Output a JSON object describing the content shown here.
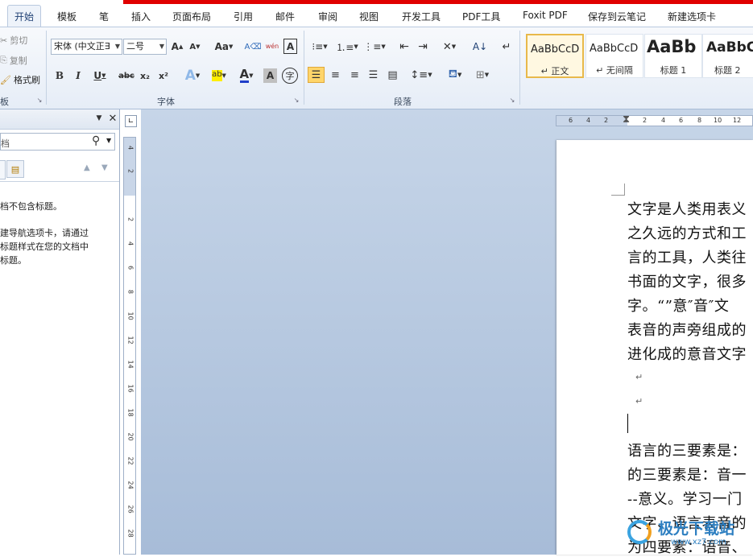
{
  "tabs": [
    {
      "label": "开始",
      "active": true
    },
    {
      "label": "模板"
    },
    {
      "label": "笔"
    },
    {
      "label": "插入"
    },
    {
      "label": "页面布局"
    },
    {
      "label": "引用"
    },
    {
      "label": "邮件"
    },
    {
      "label": "审阅"
    },
    {
      "label": "视图"
    },
    {
      "label": "开发工具"
    },
    {
      "label": "PDF工具"
    },
    {
      "label": "Foxit PDF"
    },
    {
      "label": "保存到云笔记"
    },
    {
      "label": "新建选项卡"
    }
  ],
  "clipboard": {
    "cut": "剪切",
    "copy": "复制",
    "format_painter": "格式刷",
    "group_label": "板"
  },
  "font": {
    "name": "宋体 (中文正∃",
    "size": "二号",
    "grow": "A",
    "shrink": "A",
    "change_case": "Aa",
    "bold": "B",
    "italic": "I",
    "underline": "U",
    "strike": "abc",
    "subscript": "x₂",
    "superscript": "x²",
    "text_effect": "A",
    "highlight": "ab",
    "font_color": "A",
    "char_shading": "A",
    "enclose": "字",
    "pinyin": "wén",
    "border_char": "A",
    "group_label": "字体"
  },
  "paragraph": {
    "group_label": "段落"
  },
  "styles": [
    {
      "sample": "AaBbCcD",
      "name": "↵ 正文",
      "selected": true
    },
    {
      "sample": "AaBbCcD",
      "name": "↵ 无间隔"
    },
    {
      "sample": "AaBb",
      "name": "标题 1"
    },
    {
      "sample": "AaBbC",
      "name": "标题 2"
    }
  ],
  "nav": {
    "search_text": "档",
    "body_lines": [
      "档不包含标题。",
      "",
      "建导航选项卡，请通过",
      "标题样式在您的文档中",
      "标题。"
    ]
  },
  "ruler": {
    "h_ticks": [
      "6",
      "4",
      "2",
      "",
      "2",
      "4",
      "6",
      "8",
      "10",
      "12"
    ],
    "v_ticks": [
      "4",
      "2",
      "",
      "2",
      "4",
      "6",
      "8",
      "10",
      "12",
      "14",
      "16",
      "18",
      "20",
      "22",
      "24",
      "26",
      "28"
    ]
  },
  "document": {
    "lines": [
      "文字是人类用表义",
      "之久远的方式和工",
      "言的工具，人类往",
      "书面的文字，很多",
      "字。“”意″音″文",
      "表音的声旁组成的",
      "进化成的意音文字",
      "↵",
      "↵",
      "",
      "语言的三要素是：",
      "的三要素是：音一",
      "--意义。学习一门",
      "文字、语言表音的",
      "为四要素：语音、"
    ]
  },
  "watermark": {
    "text": "极光下载站",
    "url": "www.xz7.com"
  },
  "colors": {
    "accent": "#1e3f73",
    "tab_red": "#e00000",
    "canvas": "#b7c9e0"
  }
}
